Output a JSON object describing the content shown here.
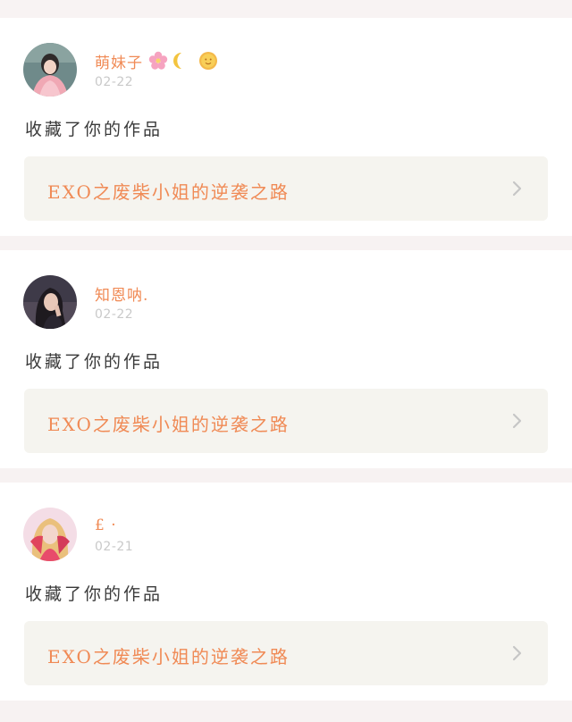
{
  "feed": [
    {
      "username": "萌妹子",
      "emoji_icons": [
        "cherry-blossom-icon",
        "crescent-moon-icon",
        "sun-face-icon"
      ],
      "date": "02-22",
      "action": "收藏了你的作品",
      "work_title": "EXO之废柴小姐的逆袭之路"
    },
    {
      "username": "知恩呐.",
      "emoji_icons": [],
      "date": "02-22",
      "action": "收藏了你的作品",
      "work_title": "EXO之废柴小姐的逆袭之路"
    },
    {
      "username": "£ ·",
      "emoji_icons": [],
      "date": "02-21",
      "action": "收藏了你的作品",
      "work_title": "EXO之废柴小姐的逆袭之路"
    }
  ],
  "colors": {
    "accent": "#f08a55",
    "date": "#c9c9c9",
    "card_bg": "#ffffff",
    "page_bg": "#f7f2f2",
    "work_bg": "#f5f4ef",
    "chevron": "#c6c6c6"
  }
}
